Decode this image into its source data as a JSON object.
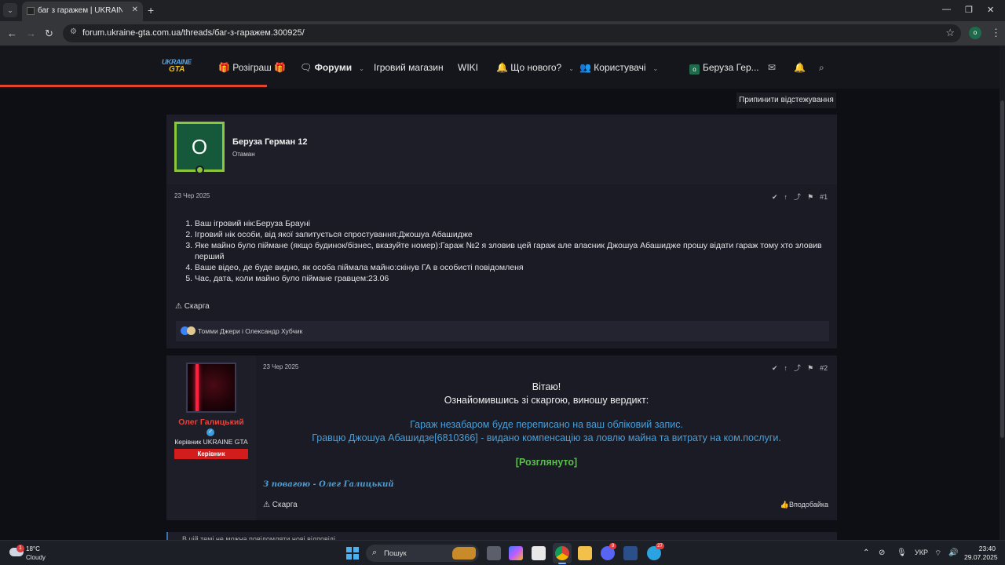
{
  "browser": {
    "tab_title": "баг з гаражем | UKRAINE GTA",
    "tab_close": "✕",
    "new_tab": "+",
    "url": "forum.ukraine-gta.com.ua/threads/баг-з-гаражем.300925/",
    "profile_initial": "o"
  },
  "site": {
    "logo_line1": "UKRAINE",
    "logo_line2": "GTA",
    "nav": {
      "giveaway": "🎁 Розіграш 🎁",
      "forums": "Форуми",
      "store": "Ігровий магазин",
      "wiki": "WIKI",
      "whats_new": "Що нового?",
      "members": "Користувачі",
      "user": "Беруза Гер..."
    },
    "stop_watching": "Припинити відстежування"
  },
  "post1": {
    "avatar_letter": "O",
    "author": "Беруза Герман 12",
    "user_title": "Отаман",
    "date": "23 Чер 2025",
    "number": "#1",
    "items": [
      "Ваш ігровий нік:Беруза Брауні",
      "Ігровий нік особи, від якої запитується спростування:Джошуа Абашидже",
      "Яке майно було піймане (якщо будинок/бізнес, вказуйте номер):Гараж №2 я зловив цей гараж але власник Джошуа Абашидже прошу відати гараж тому хто зловив перший",
      "Ваше відео, де буде видно, як особа піймала майно:скінув ГА в особисті повідомленя",
      "Час, дата, коли майно було піймане гравцем:23.06"
    ],
    "report": "Скарга",
    "reactions": "Томми Джери і Олександр Хубчик"
  },
  "post2": {
    "author": "Олег Галицький",
    "role": "Керівник UKRAINE GTA",
    "badge": "Керівник",
    "date": "23 Чер 2025",
    "number": "#2",
    "greeting": "Вітаю!",
    "intro": "Ознайомившись зі скаргою, виношу вердикт:",
    "line1": "Гараж незабаром буде переписано на ваш обліковий запис.",
    "line2": "Гравцю Джошуа Абашидзе[6810366] - видано компенсацію за ловлю майна та витрату на ком.послуги.",
    "status": "[Розглянуто]",
    "signature": "З повагою - Олег Галицький",
    "report": "Скарга",
    "like": "Вподобайка"
  },
  "notice": "В цій темі не можна повідомляти нові відповіді.",
  "taskbar": {
    "temp": "18°C",
    "condition": "Cloudy",
    "weather_badge": "1",
    "search": "Пошук",
    "lang": "УКР",
    "time": "23:40",
    "date": "29.07.2025",
    "discord_badge": "9",
    "telegram_badge": "27"
  },
  "colors": {
    "accent_red": "#e2452c",
    "status_green": "#5bbf4d",
    "text_blue": "#4a9fd9",
    "badge_red": "#d31c1c"
  }
}
